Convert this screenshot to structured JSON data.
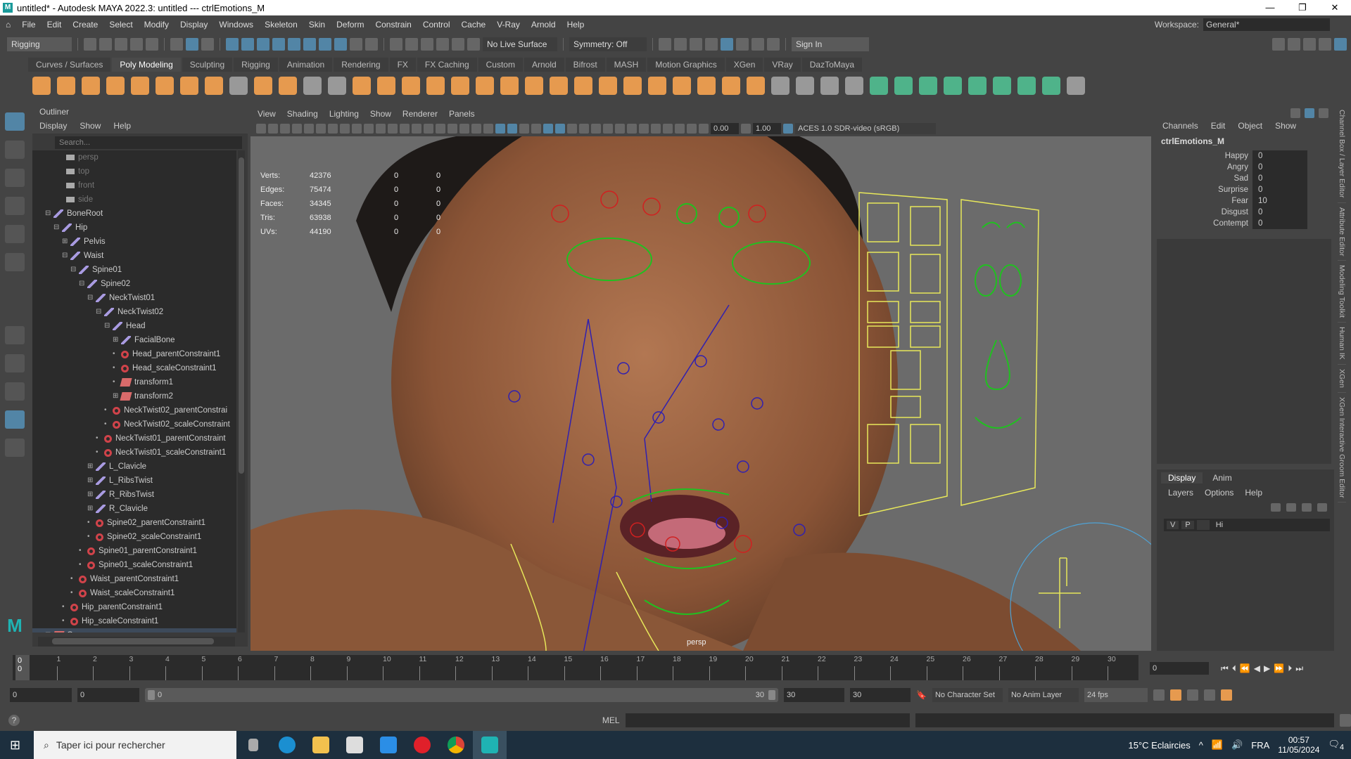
{
  "titlebar": {
    "title": "untitled* - Autodesk MAYA 2022.3: untitled   ---   ctrlEmotions_M",
    "minimize": "—",
    "maximize": "❐",
    "close": "✕"
  },
  "menu": [
    "File",
    "Edit",
    "Create",
    "Select",
    "Modify",
    "Display",
    "Windows",
    "Skeleton",
    "Skin",
    "Deform",
    "Constrain",
    "Control",
    "Cache",
    "V-Ray",
    "Arnold",
    "Help"
  ],
  "workspace": {
    "label": "Workspace:",
    "value": "General*"
  },
  "statusline": {
    "mode": "Rigging",
    "live_surface": "No Live Surface",
    "symmetry": "Symmetry: Off",
    "sign_in": "Sign In"
  },
  "shelf_tabs": [
    "Curves / Surfaces",
    "Poly Modeling",
    "Sculpting",
    "Rigging",
    "Animation",
    "Rendering",
    "FX",
    "FX Caching",
    "Custom",
    "Arnold",
    "Bifrost",
    "MASH",
    "Motion Graphics",
    "XGen",
    "VRay",
    "DazToMaya"
  ],
  "shelf_active": "Poly Modeling",
  "outliner": {
    "title": "Outliner",
    "menu": [
      "Display",
      "Show",
      "Help"
    ],
    "search_placeholder": "Search...",
    "items": [
      {
        "label": "persp",
        "type": "cam",
        "depth": 0
      },
      {
        "label": "top",
        "type": "cam",
        "depth": 0
      },
      {
        "label": "front",
        "type": "cam",
        "depth": 0
      },
      {
        "label": "side",
        "type": "cam",
        "depth": 0
      },
      {
        "label": "BoneRoot",
        "type": "joint",
        "depth": 0,
        "exp": "-"
      },
      {
        "label": "Hip",
        "type": "joint",
        "depth": 1,
        "exp": "-"
      },
      {
        "label": "Pelvis",
        "type": "joint",
        "depth": 2,
        "exp": "+"
      },
      {
        "label": "Waist",
        "type": "joint",
        "depth": 2,
        "exp": "-"
      },
      {
        "label": "Spine01",
        "type": "joint",
        "depth": 3,
        "exp": "-"
      },
      {
        "label": "Spine02",
        "type": "joint",
        "depth": 4,
        "exp": "-"
      },
      {
        "label": "NeckTwist01",
        "type": "joint",
        "depth": 5,
        "exp": "-"
      },
      {
        "label": "NeckTwist02",
        "type": "joint",
        "depth": 6,
        "exp": "-"
      },
      {
        "label": "Head",
        "type": "joint",
        "depth": 7,
        "exp": "-"
      },
      {
        "label": "FacialBone",
        "type": "joint",
        "depth": 8,
        "exp": "+"
      },
      {
        "label": "Head_parentConstraint1",
        "type": "cons",
        "depth": 8
      },
      {
        "label": "Head_scaleConstraint1",
        "type": "cons",
        "depth": 8
      },
      {
        "label": "transform1",
        "type": "xf",
        "depth": 8
      },
      {
        "label": "transform2",
        "type": "xf",
        "depth": 8,
        "exp": "+"
      },
      {
        "label": "NeckTwist02_parentConstrai",
        "type": "cons",
        "depth": 7
      },
      {
        "label": "NeckTwist02_scaleConstraint",
        "type": "cons",
        "depth": 7
      },
      {
        "label": "NeckTwist01_parentConstraint",
        "type": "cons",
        "depth": 6
      },
      {
        "label": "NeckTwist01_scaleConstraint1",
        "type": "cons",
        "depth": 6
      },
      {
        "label": "L_Clavicle",
        "type": "joint",
        "depth": 5,
        "exp": "+"
      },
      {
        "label": "L_RibsTwist",
        "type": "joint",
        "depth": 5,
        "exp": "+"
      },
      {
        "label": "R_RibsTwist",
        "type": "joint",
        "depth": 5,
        "exp": "+"
      },
      {
        "label": "R_Clavicle",
        "type": "joint",
        "depth": 5,
        "exp": "+"
      },
      {
        "label": "Spine02_parentConstraint1",
        "type": "cons",
        "depth": 5
      },
      {
        "label": "Spine02_scaleConstraint1",
        "type": "cons",
        "depth": 5
      },
      {
        "label": "Spine01_parentConstraint1",
        "type": "cons",
        "depth": 4
      },
      {
        "label": "Spine01_scaleConstraint1",
        "type": "cons",
        "depth": 4
      },
      {
        "label": "Waist_parentConstraint1",
        "type": "cons",
        "depth": 3
      },
      {
        "label": "Waist_scaleConstraint1",
        "type": "cons",
        "depth": 3
      },
      {
        "label": "Hip_parentConstraint1",
        "type": "cons",
        "depth": 2
      },
      {
        "label": "Hip_scaleConstraint1",
        "type": "cons",
        "depth": 2
      },
      {
        "label": "Group",
        "type": "xf",
        "depth": 0,
        "exp": "+"
      }
    ]
  },
  "viewport": {
    "menu": [
      "View",
      "Shading",
      "Lighting",
      "Show",
      "Renderer",
      "Panels"
    ],
    "exposure": "0.00",
    "gamma": "1.00",
    "colorspace": "ACES 1.0 SDR-video (sRGB)",
    "camera": "persp",
    "hud": [
      {
        "label": "Verts:",
        "v1": "42376",
        "v2": "0",
        "v3": "0"
      },
      {
        "label": "Edges:",
        "v1": "75474",
        "v2": "0",
        "v3": "0"
      },
      {
        "label": "Faces:",
        "v1": "34345",
        "v2": "0",
        "v3": "0"
      },
      {
        "label": "Tris:",
        "v1": "63938",
        "v2": "0",
        "v3": "0"
      },
      {
        "label": "UVs:",
        "v1": "44190",
        "v2": "0",
        "v3": "0"
      }
    ]
  },
  "channelbox": {
    "menu": [
      "Channels",
      "Edit",
      "Object",
      "Show"
    ],
    "object": "ctrlEmotions_M",
    "channels": [
      {
        "name": "Happy",
        "value": "0"
      },
      {
        "name": "Angry",
        "value": "0"
      },
      {
        "name": "Sad",
        "value": "0"
      },
      {
        "name": "Surprise",
        "value": "0"
      },
      {
        "name": "Fear",
        "value": "10"
      },
      {
        "name": "Disgust",
        "value": "0"
      },
      {
        "name": "Contempt",
        "value": "0"
      }
    ]
  },
  "layer_editor": {
    "tabs": [
      "Display",
      "Anim"
    ],
    "menu": [
      "Layers",
      "Options",
      "Help"
    ],
    "row": {
      "v": "V",
      "p": "P",
      "name": "Hi"
    }
  },
  "right_tabs": [
    "Channel Box / Layer Editor",
    "Attribute Editor",
    "Modeling Toolkit",
    "Human IK",
    "XGen",
    "XGen Interactive Groom Editor"
  ],
  "timeline": {
    "ticks": [
      "0",
      "1",
      "2",
      "3",
      "4",
      "5",
      "6",
      "7",
      "8",
      "9",
      "10",
      "11",
      "12",
      "13",
      "14",
      "15",
      "16",
      "17",
      "18",
      "19",
      "20",
      "21",
      "22",
      "23",
      "24",
      "25",
      "26",
      "27",
      "28",
      "29",
      "30"
    ],
    "current": "0",
    "current_field": "0"
  },
  "range": {
    "start": "0",
    "anim_start": "0",
    "slider_start": "0",
    "slider_end": "30",
    "anim_end": "30",
    "end": "30",
    "character_set": "No Character Set",
    "anim_layer": "No Anim Layer",
    "fps": "24 fps"
  },
  "cmdline": {
    "lang": "MEL",
    "help": "?"
  },
  "taskbar": {
    "search": "Taper ici pour rechercher",
    "weather": "15°C  Eclaircies",
    "lang": "FRA",
    "time": "00:57",
    "date": "11/05/2024",
    "notifications": "4"
  }
}
